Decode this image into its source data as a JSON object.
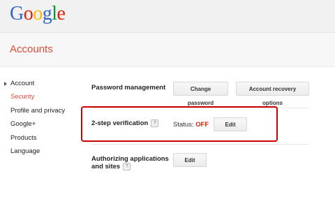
{
  "brand": {
    "logo_letters": [
      "G",
      "o",
      "o",
      "g",
      "l",
      "e"
    ],
    "logo_colors": [
      "#3366cc",
      "#dd2200",
      "#ffbb00",
      "#3366cc",
      "#009933",
      "#dd2200"
    ]
  },
  "header": {
    "title": "Accounts"
  },
  "sidebar": {
    "items": [
      {
        "label": "Account"
      },
      {
        "label": "Security",
        "selected": true
      },
      {
        "label": "Profile and privacy"
      },
      {
        "label": "Google+"
      },
      {
        "label": "Products"
      },
      {
        "label": "Language"
      }
    ]
  },
  "security": {
    "password": {
      "label": "Password management",
      "change_button": "Change password",
      "recovery_button": "Account recovery options"
    },
    "two_step": {
      "label": "2-step verification",
      "help": "?",
      "status_label": "Status:",
      "status_value": "OFF",
      "edit_button": "Edit"
    },
    "authorizing": {
      "label_line1": "Authorizing applications",
      "label_line2": "and sites",
      "help": "?",
      "edit_button": "Edit"
    }
  },
  "colors": {
    "accent_red": "#dd2200",
    "highlight_border": "#cc0000",
    "topbar_bg": "#f1f1f1"
  }
}
